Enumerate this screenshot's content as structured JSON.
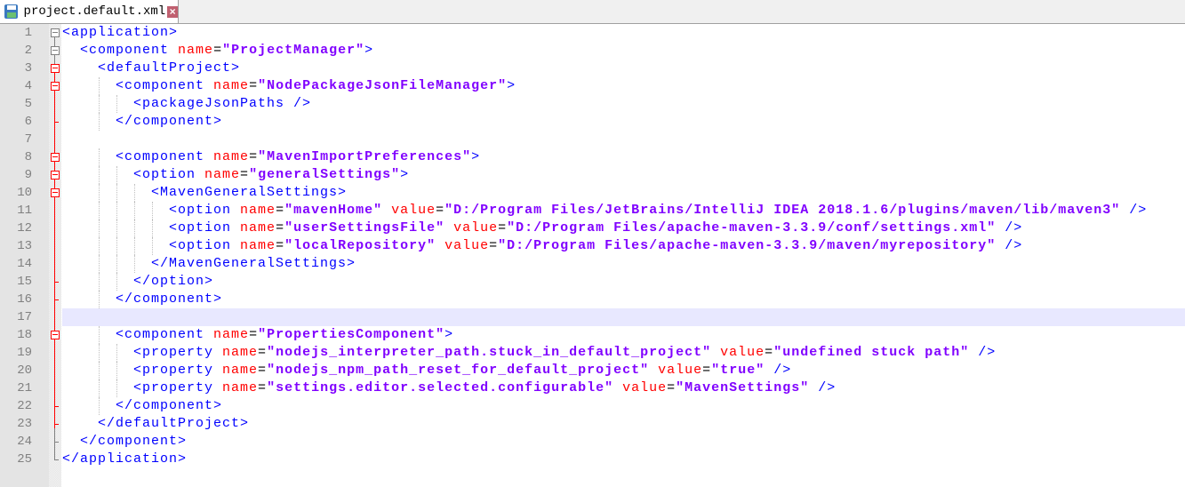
{
  "tab": {
    "filename": "project.default.xml",
    "icon": "save-icon",
    "close_icon": "close-icon"
  },
  "editor": {
    "highlight_line": 17,
    "lines": [
      {
        "i": 0,
        "t": [
          [
            "tag",
            "<application>"
          ]
        ]
      },
      {
        "i": 1,
        "t": [
          [
            "tag",
            "<component "
          ],
          [
            "attr",
            "name"
          ],
          [
            "eq",
            "="
          ],
          [
            "val",
            "\"ProjectManager\""
          ],
          [
            "tag",
            ">"
          ]
        ]
      },
      {
        "i": 2,
        "t": [
          [
            "tag",
            "<defaultProject>"
          ]
        ]
      },
      {
        "i": 3,
        "t": [
          [
            "tag",
            "<component "
          ],
          [
            "attr",
            "name"
          ],
          [
            "eq",
            "="
          ],
          [
            "val",
            "\"NodePackageJsonFileManager\""
          ],
          [
            "tag",
            ">"
          ]
        ]
      },
      {
        "i": 4,
        "t": [
          [
            "tag",
            "<packageJsonPaths />"
          ]
        ]
      },
      {
        "i": 3,
        "t": [
          [
            "tag",
            "</component>"
          ]
        ]
      },
      {
        "i": 0,
        "t": []
      },
      {
        "i": 3,
        "t": [
          [
            "tag",
            "<component "
          ],
          [
            "attr",
            "name"
          ],
          [
            "eq",
            "="
          ],
          [
            "val",
            "\"MavenImportPreferences\""
          ],
          [
            "tag",
            ">"
          ]
        ]
      },
      {
        "i": 4,
        "t": [
          [
            "tag",
            "<option "
          ],
          [
            "attr",
            "name"
          ],
          [
            "eq",
            "="
          ],
          [
            "val",
            "\"generalSettings\""
          ],
          [
            "tag",
            ">"
          ]
        ]
      },
      {
        "i": 5,
        "t": [
          [
            "tag",
            "<MavenGeneralSettings>"
          ]
        ]
      },
      {
        "i": 6,
        "t": [
          [
            "tag",
            "<option "
          ],
          [
            "attr",
            "name"
          ],
          [
            "eq",
            "="
          ],
          [
            "val",
            "\"mavenHome\""
          ],
          [
            "txt",
            " "
          ],
          [
            "attr",
            "value"
          ],
          [
            "eq",
            "="
          ],
          [
            "val",
            "\"D:/Program Files/JetBrains/IntelliJ IDEA 2018.1.6/plugins/maven/lib/maven3\""
          ],
          [
            "tag",
            " />"
          ]
        ]
      },
      {
        "i": 6,
        "t": [
          [
            "tag",
            "<option "
          ],
          [
            "attr",
            "name"
          ],
          [
            "eq",
            "="
          ],
          [
            "val",
            "\"userSettingsFile\""
          ],
          [
            "txt",
            " "
          ],
          [
            "attr",
            "value"
          ],
          [
            "eq",
            "="
          ],
          [
            "val",
            "\"D:/Program Files/apache-maven-3.3.9/conf/settings.xml\""
          ],
          [
            "tag",
            " />"
          ]
        ]
      },
      {
        "i": 6,
        "t": [
          [
            "tag",
            "<option "
          ],
          [
            "attr",
            "name"
          ],
          [
            "eq",
            "="
          ],
          [
            "val",
            "\"localRepository\""
          ],
          [
            "txt",
            " "
          ],
          [
            "attr",
            "value"
          ],
          [
            "eq",
            "="
          ],
          [
            "val",
            "\"D:/Program Files/apache-maven-3.3.9/maven/myrepository\""
          ],
          [
            "tag",
            " />"
          ]
        ]
      },
      {
        "i": 5,
        "t": [
          [
            "tag",
            "</MavenGeneralSettings>"
          ]
        ]
      },
      {
        "i": 4,
        "t": [
          [
            "tag",
            "</option>"
          ]
        ]
      },
      {
        "i": 3,
        "t": [
          [
            "tag",
            "</component>"
          ]
        ]
      },
      {
        "i": 0,
        "t": []
      },
      {
        "i": 3,
        "t": [
          [
            "tag",
            "<component "
          ],
          [
            "attr",
            "name"
          ],
          [
            "eq",
            "="
          ],
          [
            "val",
            "\"PropertiesComponent\""
          ],
          [
            "tag",
            ">"
          ]
        ]
      },
      {
        "i": 4,
        "t": [
          [
            "tag",
            "<property "
          ],
          [
            "attr",
            "name"
          ],
          [
            "eq",
            "="
          ],
          [
            "val",
            "\"nodejs_interpreter_path.stuck_in_default_project\""
          ],
          [
            "txt",
            " "
          ],
          [
            "attr",
            "value"
          ],
          [
            "eq",
            "="
          ],
          [
            "val",
            "\"undefined stuck path\""
          ],
          [
            "tag",
            " />"
          ]
        ]
      },
      {
        "i": 4,
        "t": [
          [
            "tag",
            "<property "
          ],
          [
            "attr",
            "name"
          ],
          [
            "eq",
            "="
          ],
          [
            "val",
            "\"nodejs_npm_path_reset_for_default_project\""
          ],
          [
            "txt",
            " "
          ],
          [
            "attr",
            "value"
          ],
          [
            "eq",
            "="
          ],
          [
            "val",
            "\"true\""
          ],
          [
            "tag",
            " />"
          ]
        ]
      },
      {
        "i": 4,
        "t": [
          [
            "tag",
            "<property "
          ],
          [
            "attr",
            "name"
          ],
          [
            "eq",
            "="
          ],
          [
            "val",
            "\"settings.editor.selected.configurable\""
          ],
          [
            "txt",
            " "
          ],
          [
            "attr",
            "value"
          ],
          [
            "eq",
            "="
          ],
          [
            "val",
            "\"MavenSettings\""
          ],
          [
            "tag",
            " />"
          ]
        ]
      },
      {
        "i": 3,
        "t": [
          [
            "tag",
            "</component>"
          ]
        ]
      },
      {
        "i": 2,
        "t": [
          [
            "tag",
            "</defaultProject>"
          ]
        ]
      },
      {
        "i": 1,
        "t": [
          [
            "tag",
            "</component>"
          ]
        ]
      },
      {
        "i": 0,
        "t": [
          [
            "tag",
            "</application>"
          ]
        ]
      }
    ]
  },
  "fold": {
    "open_gray": [
      1,
      2
    ],
    "open_red": [
      3,
      4,
      8,
      9,
      10,
      18
    ],
    "end_gray": [
      24,
      25
    ],
    "end_red": [
      6,
      15,
      16,
      22,
      23
    ]
  }
}
